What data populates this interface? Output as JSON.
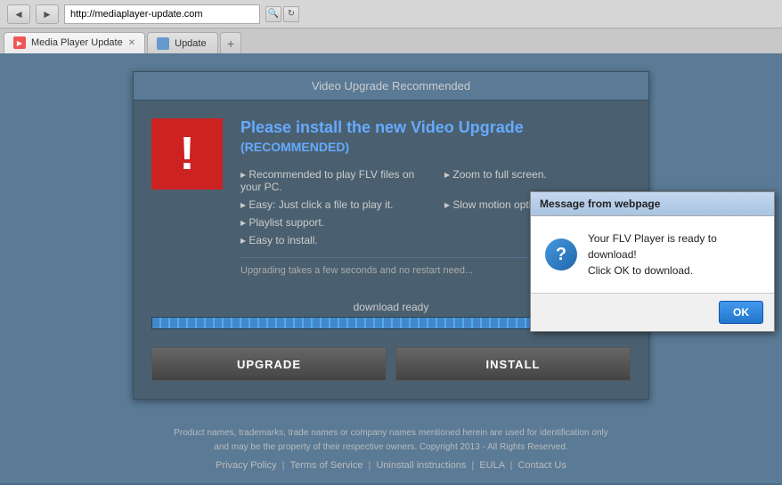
{
  "browser": {
    "back_btn": "◄",
    "forward_btn": "►",
    "address_value": "http://mediaplayer-update.com",
    "search_icon": "🔍",
    "refresh_icon": "↻",
    "tab1_label": "Media Player Update",
    "tab1_close": "✕",
    "tab2_label": "Update",
    "new_tab_label": "+"
  },
  "page": {
    "header_title": "Video Upgrade Recommended",
    "warning_symbol": "!",
    "main_title": "Please install the new Video Upgrade",
    "recommended_label": "(RECOMMENDED)",
    "feature1": "▸ Recommended to play FLV files on your PC.",
    "feature2": "▸ Zoom to full screen.",
    "feature3": "▸ Easy: Just click a file to play it.",
    "feature4": "▸ Slow motion option.",
    "feature5": "▸ Playlist support.",
    "feature6": "",
    "feature7": "▸ Easy to install.",
    "upgrade_note": "Upgrading takes a few seconds and no restart need...",
    "download_label": "download ready",
    "upgrade_btn": "UPGRADE",
    "install_btn": "INSTALL"
  },
  "footer": {
    "disclaimer": "Product names, trademarks, trade names or company names mentioned herein are used for identification only\nand may be the property of their respective owners. Copyright 2013 - All Rights Reserved.",
    "privacy_link": "Privacy Policy",
    "terms_link": "Terms of Service",
    "uninstall_link": "Uninstall instructions",
    "eula_link": "EULA",
    "contact_link": "Contact Us",
    "separator": "|"
  },
  "dialog": {
    "title": "Message from webpage",
    "question_icon": "?",
    "message_line1": "Your FLV Player is ready to download!",
    "message_line2": "Click OK to download.",
    "ok_btn": "OK"
  }
}
